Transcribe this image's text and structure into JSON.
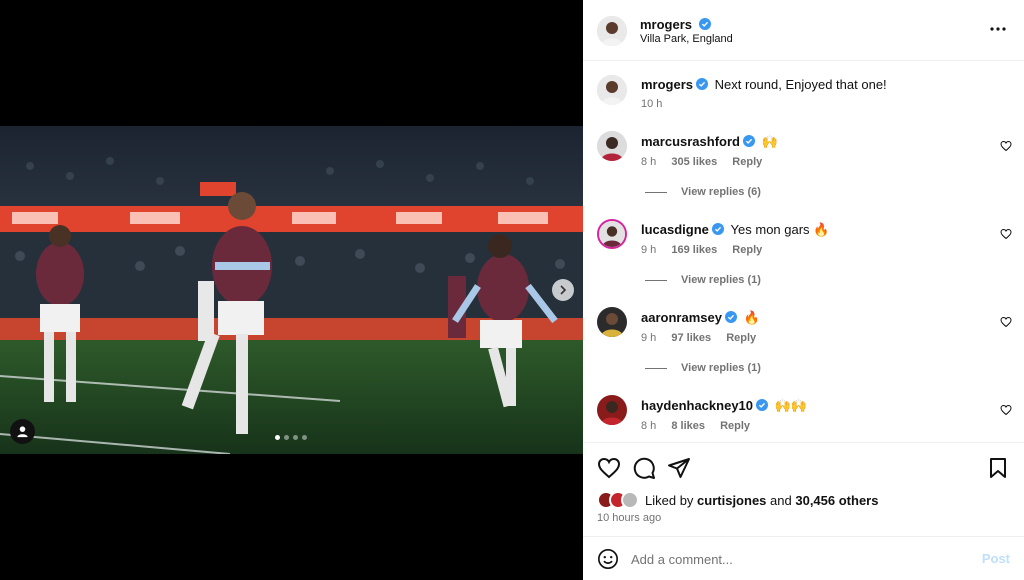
{
  "post": {
    "author": "mrogers",
    "location": "Villa Park, England",
    "caption": "Next round, Enjoyed that one!",
    "caption_time": "10 h",
    "carousel_count": 4,
    "carousel_active_index": 0
  },
  "comments": [
    {
      "user": "marcusrashford",
      "text": "🙌",
      "time": "8 h",
      "likes": "305 likes",
      "reply": "Reply",
      "view_replies": "View replies (6)"
    },
    {
      "user": "lucasdigne",
      "text": "Yes mon gars 🔥",
      "time": "9 h",
      "likes": "169 likes",
      "reply": "Reply",
      "view_replies": "View replies (1)"
    },
    {
      "user": "aaronramsey",
      "text": "🔥",
      "time": "9 h",
      "likes": "97 likes",
      "reply": "Reply",
      "view_replies": "View replies (1)"
    },
    {
      "user": "haydenhackney10",
      "text": "🙌🙌",
      "time": "8 h",
      "likes": "8 likes",
      "reply": "Reply"
    }
  ],
  "engagement": {
    "liked_by_prefix": "Liked by",
    "liked_by_user": "curtisjones",
    "and": "and",
    "others": "30,456 others",
    "posted_ago": "10 hours ago"
  },
  "comment_box": {
    "placeholder": "Add a comment...",
    "post_label": "Post"
  },
  "icons": {
    "more": "more-horizontal-icon",
    "like": "heart-icon",
    "comment": "comment-bubble-icon",
    "share": "paper-plane-icon",
    "save": "bookmark-icon",
    "emoji": "emoji-smile-icon",
    "verified": "verified-badge-icon",
    "next": "chevron-right-icon",
    "tag": "user-tag-icon"
  },
  "colors": {
    "verified_blue": "#3897f0",
    "post_button_disabled": "#c0dffd",
    "kit_claret": "#6b2a3c",
    "banner_red": "#e0442e"
  }
}
